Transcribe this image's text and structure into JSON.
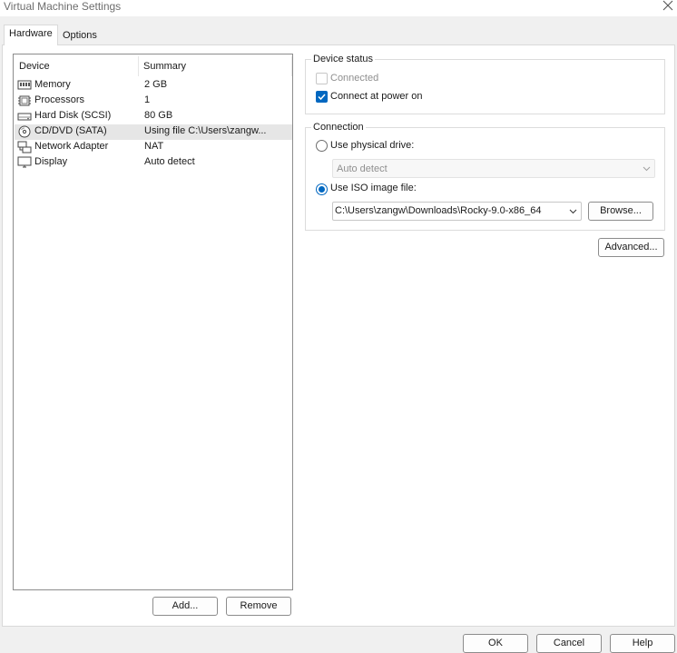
{
  "window": {
    "title": "Virtual Machine Settings"
  },
  "tabs": [
    {
      "label": "Hardware",
      "active": true
    },
    {
      "label": "Options",
      "active": false
    }
  ],
  "device_table": {
    "headers": [
      "Device",
      "Summary"
    ],
    "rows": [
      {
        "icon": "memory-icon",
        "device": "Memory",
        "summary": "2 GB"
      },
      {
        "icon": "processor-icon",
        "device": "Processors",
        "summary": "1"
      },
      {
        "icon": "hard-disk-icon",
        "device": "Hard Disk (SCSI)",
        "summary": "80 GB"
      },
      {
        "icon": "cd-dvd-icon",
        "device": "CD/DVD (SATA)",
        "summary": "Using file C:\\Users\\zangw...",
        "selected": true
      },
      {
        "icon": "network-adapter-icon",
        "device": "Network Adapter",
        "summary": "NAT"
      },
      {
        "icon": "display-icon",
        "device": "Display",
        "summary": "Auto detect"
      }
    ]
  },
  "list_buttons": {
    "add": "Add...",
    "remove": "Remove"
  },
  "device_status": {
    "title": "Device status",
    "connected": {
      "label": "Connected",
      "checked": false,
      "enabled": false
    },
    "connect_at_power_on": {
      "label": "Connect at power on",
      "checked": true
    }
  },
  "connection": {
    "title": "Connection",
    "use_physical_drive": {
      "label": "Use physical drive:",
      "selected": false
    },
    "physical_drive_value": "Auto detect",
    "use_iso_image": {
      "label": "Use ISO image file:",
      "selected": true
    },
    "iso_path": "C:\\Users\\zangw\\Downloads\\Rocky-9.0-x86_64",
    "browse": "Browse..."
  },
  "advanced_button": "Advanced...",
  "footer": {
    "ok": "OK",
    "cancel": "Cancel",
    "help": "Help"
  },
  "colors": {
    "accent": "#0067c0",
    "selection": "#e6e6e6"
  }
}
